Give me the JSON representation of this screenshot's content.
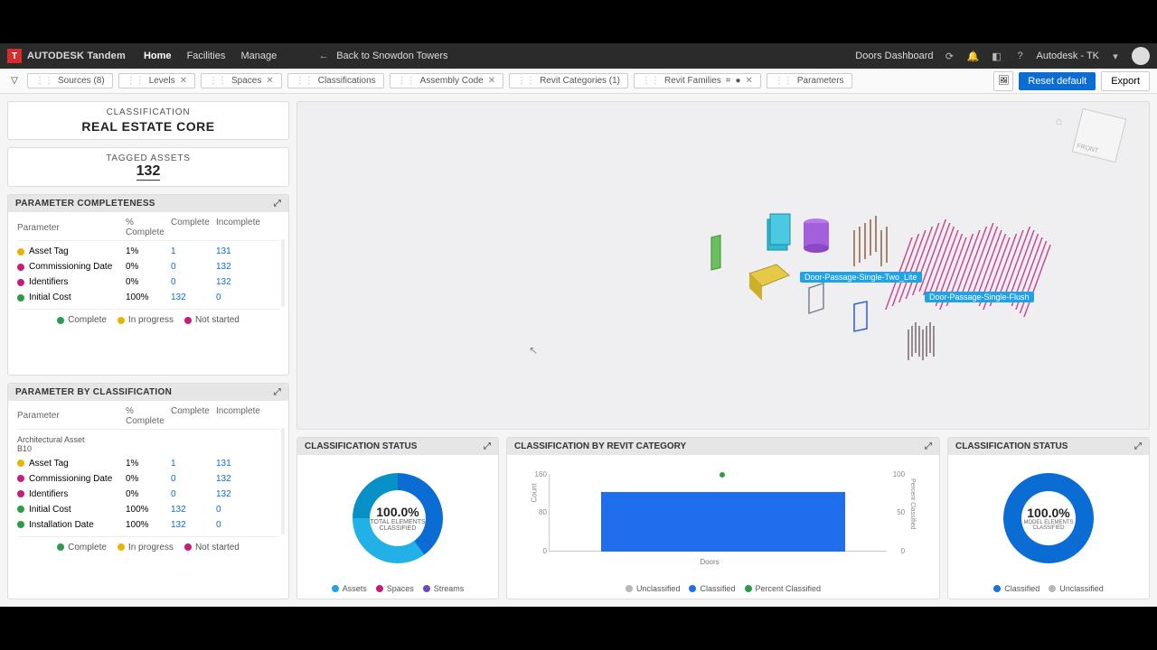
{
  "header": {
    "brand": "AUTODESK Tandem",
    "nav": [
      "Home",
      "Facilities",
      "Manage"
    ],
    "back": "Back to Snowdon Towers",
    "dashboard": "Doors Dashboard",
    "user": "Autodesk - TK"
  },
  "chips": [
    {
      "label": "Sources (8)",
      "close": false
    },
    {
      "label": "Levels",
      "close": true
    },
    {
      "label": "Spaces",
      "close": true
    },
    {
      "label": "Classifications",
      "close": false
    },
    {
      "label": "Assembly Code",
      "close": true
    },
    {
      "label": "Revit Categories (1)",
      "close": false
    },
    {
      "label": "Revit Families",
      "close": true,
      "extra": true
    },
    {
      "label": "Parameters",
      "close": false
    }
  ],
  "actions": {
    "reset": "Reset default",
    "export": "Export"
  },
  "classification": {
    "title": "CLASSIFICATION",
    "value": "REAL ESTATE CORE"
  },
  "tagged": {
    "title": "TAGGED ASSETS",
    "value": "132"
  },
  "param_completeness": {
    "title": "PARAMETER COMPLETENESS",
    "cols": [
      "Parameter",
      "% Complete",
      "Complete",
      "Incomplete"
    ],
    "rows": [
      {
        "dot": "#e8b400",
        "name": "Asset Tag",
        "pct": "1%",
        "c": "1",
        "i": "131"
      },
      {
        "dot": "#c41e7a",
        "name": "Commissioning Date",
        "pct": "0%",
        "c": "0",
        "i": "132"
      },
      {
        "dot": "#c41e7a",
        "name": "Identifiers",
        "pct": "0%",
        "c": "0",
        "i": "132"
      },
      {
        "dot": "#2e9b4a",
        "name": "Initial Cost",
        "pct": "100%",
        "c": "132",
        "i": "0"
      }
    ],
    "legend": [
      "Complete",
      "In progress",
      "Not started"
    ]
  },
  "param_by_class": {
    "title": "PARAMETER BY CLASSIFICATION",
    "cols": [
      "Parameter",
      "% Complete",
      "Complete",
      "Incomplete"
    ],
    "group": "Architectural Asset\nB10",
    "rows": [
      {
        "dot": "#e8b400",
        "name": "Asset Tag",
        "pct": "1%",
        "c": "1",
        "i": "131"
      },
      {
        "dot": "#c41e7a",
        "name": "Commissioning Date",
        "pct": "0%",
        "c": "0",
        "i": "132"
      },
      {
        "dot": "#c41e7a",
        "name": "Identifiers",
        "pct": "0%",
        "c": "0",
        "i": "132"
      },
      {
        "dot": "#2e9b4a",
        "name": "Initial Cost",
        "pct": "100%",
        "c": "132",
        "i": "0"
      },
      {
        "dot": "#2e9b4a",
        "name": "Installation Date",
        "pct": "100%",
        "c": "132",
        "i": "0"
      }
    ],
    "legend": [
      "Complete",
      "In progress",
      "Not started"
    ]
  },
  "viewer": {
    "labels": [
      "Door-Passage-Single-Two_Lite",
      "Door-Passage-Single-Flush"
    ]
  },
  "dash1": {
    "title": "CLASSIFICATION STATUS",
    "center": "100.0%",
    "sub1": "TOTAL ELEMENTS",
    "sub2": "CLASSIFIED",
    "legend": [
      {
        "c": "#1fa3e8",
        "t": "Assets"
      },
      {
        "c": "#c41e7a",
        "t": "Spaces"
      },
      {
        "c": "#6a4bc1",
        "t": "Streams"
      }
    ]
  },
  "dash2": {
    "title": "CLASSIFICATION BY REVIT CATEGORY",
    "legend": [
      {
        "c": "#b7b7b7",
        "t": "Unclassified"
      },
      {
        "c": "#1f6fec",
        "t": "Classified"
      },
      {
        "c": "#2e9b4a",
        "t": "Percent Classified"
      }
    ],
    "xcat": "Doors",
    "ylabel": "Count",
    "y2label": "Percent Classified"
  },
  "dash3": {
    "title": "CLASSIFICATION STATUS",
    "center": "100.0%",
    "sub1": "MODEL ELEMENTS",
    "sub2": "CLASSIFIED",
    "legend": [
      {
        "c": "#1f6fec",
        "t": "Classified"
      },
      {
        "c": "#b7b7b7",
        "t": "Unclassified"
      }
    ]
  },
  "chart_data": [
    {
      "type": "pie",
      "title": "Classification Status (Assets/Spaces/Streams)",
      "series": [
        {
          "name": "Assets",
          "value": 40
        },
        {
          "name": "Spaces",
          "value": 35
        },
        {
          "name": "Streams",
          "value": 25
        }
      ],
      "center_label": "100.0% TOTAL ELEMENTS CLASSIFIED"
    },
    {
      "type": "bar",
      "title": "Classification by Revit Category",
      "categories": [
        "Doors"
      ],
      "series": [
        {
          "name": "Unclassified",
          "values": [
            0
          ]
        },
        {
          "name": "Classified",
          "values": [
            132
          ]
        },
        {
          "name": "Percent Classified",
          "values": [
            100
          ],
          "axis": "secondary"
        }
      ],
      "ylabel": "Count",
      "ylim": [
        0,
        160
      ],
      "y2label": "Percent Classified",
      "y2lim": [
        0,
        100
      ]
    },
    {
      "type": "pie",
      "title": "Classification Status (Classified/Unclassified)",
      "series": [
        {
          "name": "Classified",
          "value": 100
        },
        {
          "name": "Unclassified",
          "value": 0
        }
      ],
      "center_label": "100.0% MODEL ELEMENTS CLASSIFIED"
    }
  ]
}
